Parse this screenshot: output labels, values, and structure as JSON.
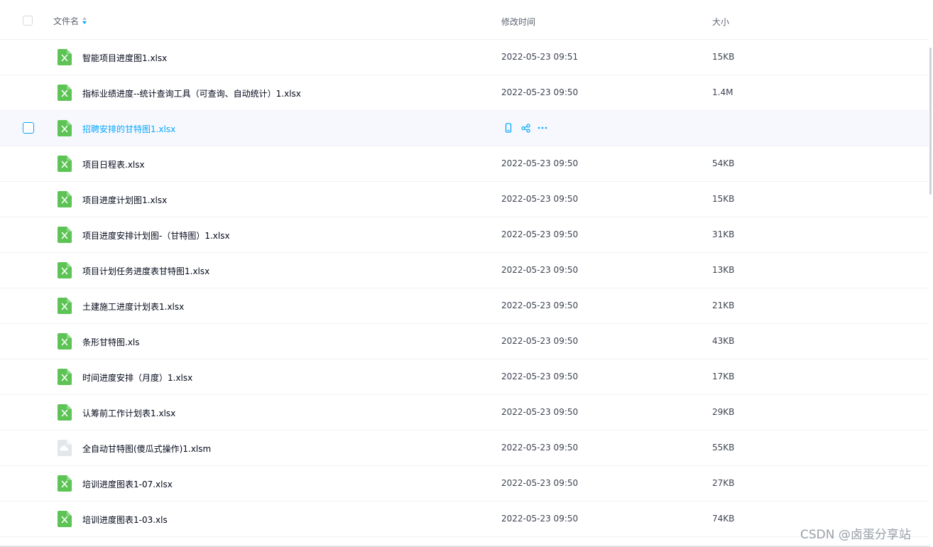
{
  "header": {
    "name_label": "文件名",
    "time_label": "修改时间",
    "size_label": "大小"
  },
  "files": [
    {
      "name": "智能项目进度图1.xlsx",
      "time": "2022-05-23 09:51",
      "size": "15KB",
      "type": "excel"
    },
    {
      "name": "指标业绩进度--统计查询工具（可查询、自动统计）1.xlsx",
      "time": "2022-05-23 09:50",
      "size": "1.4M",
      "type": "excel"
    },
    {
      "name": "招聘安排的甘特图1.xlsx",
      "time": "",
      "size": "",
      "type": "excel",
      "selected": true
    },
    {
      "name": "项目日程表.xlsx",
      "time": "2022-05-23 09:50",
      "size": "54KB",
      "type": "excel"
    },
    {
      "name": "项目进度计划图1.xlsx",
      "time": "2022-05-23 09:50",
      "size": "15KB",
      "type": "excel"
    },
    {
      "name": "项目进度安排计划图-（甘特图）1.xlsx",
      "time": "2022-05-23 09:50",
      "size": "31KB",
      "type": "excel"
    },
    {
      "name": "项目计划任务进度表甘特图1.xlsx",
      "time": "2022-05-23 09:50",
      "size": "13KB",
      "type": "excel"
    },
    {
      "name": "土建施工进度计划表1.xlsx",
      "time": "2022-05-23 09:50",
      "size": "21KB",
      "type": "excel"
    },
    {
      "name": "条形甘特图.xls",
      "time": "2022-05-23 09:50",
      "size": "43KB",
      "type": "excel"
    },
    {
      "name": "时间进度安排（月度）1.xlsx",
      "time": "2022-05-23 09:50",
      "size": "17KB",
      "type": "excel"
    },
    {
      "name": "认筹前工作计划表1.xlsx",
      "time": "2022-05-23 09:50",
      "size": "29KB",
      "type": "excel"
    },
    {
      "name": "全自动甘特图(傻瓜式操作)1.xlsm",
      "time": "2022-05-23 09:50",
      "size": "55KB",
      "type": "unknown"
    },
    {
      "name": "培训进度图表1-07.xlsx",
      "time": "2022-05-23 09:50",
      "size": "27KB",
      "type": "excel"
    },
    {
      "name": "培训进度图表1-03.xls",
      "time": "2022-05-23 09:50",
      "size": "74KB",
      "type": "excel"
    }
  ],
  "row_actions": [
    "phone-icon",
    "share-icon",
    "more-icon"
  ],
  "watermark": "CSDN @卤蛋分享站",
  "colors": {
    "accent": "#06a7ff",
    "excel_green": "#5dc355",
    "row_selected_bg": "#f6f8fd"
  }
}
